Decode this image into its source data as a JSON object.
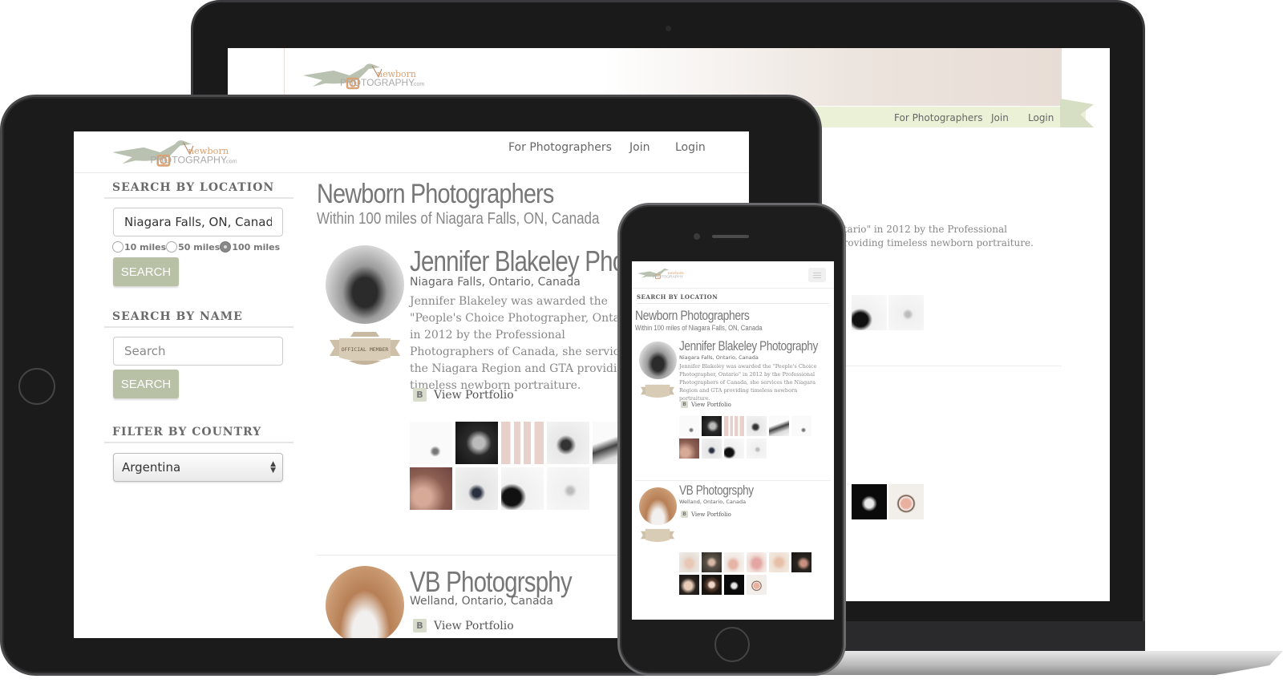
{
  "brand": {
    "logo_word_top": "newborn",
    "logo_word_main": "PHOTOGRAPHY",
    "logo_suffix": ".com",
    "accent_color": "#b8c1a6",
    "logo_orange": "#d9a274",
    "nav_band_color": "#ebf1d6"
  },
  "nav": {
    "items": [
      {
        "label": "For Photographers"
      },
      {
        "label": "Join"
      },
      {
        "label": "Login"
      }
    ]
  },
  "sidebar": {
    "location": {
      "title": "SEARCH BY LOCATION",
      "input_value": "Niagara Falls, ON, Canada",
      "radius_options": [
        {
          "label": "10 miles",
          "checked": false
        },
        {
          "label": "50 miles",
          "checked": false
        },
        {
          "label": "100 miles",
          "checked": true
        }
      ],
      "button_label": "SEARCH"
    },
    "name": {
      "title": "SEARCH BY NAME",
      "input_placeholder": "Search",
      "button_label": "SEARCH"
    },
    "country": {
      "title": "FILTER BY COUNTRY",
      "selected": "Argentina"
    }
  },
  "results": {
    "title": "Newborn Photographers",
    "subtitle": "Within 100 miles of Niagara Falls, ON, Canada",
    "profiles": [
      {
        "name": "Jennifer Blakeley Photography",
        "location": "Niagara Falls, Ontario, Canada",
        "bio": "Jennifer Blakeley was awarded the \"People's Choice Photographer, Ontario\" in 2012 by the Professional Photographers of Canada, she services the Niagara Region and GTA providing timeless newborn portraiture.",
        "badge": "OFFICIAL MEMBER",
        "link_label": "View Portfolio",
        "link_icon": "B",
        "gallery_count": 10
      },
      {
        "name": "VB Photogrsphy",
        "location": "Welland, Ontario, Canada",
        "bio": "",
        "badge": "OFFICIAL MEMBER",
        "link_label": "View Portfolio",
        "link_icon": "B",
        "gallery_count": 10
      }
    ]
  },
  "laptop_excerpt": {
    "bio_line_1": "ntario\" in 2012 by the Professional",
    "bio_line_2": "providing timeless newborn portraiture."
  }
}
